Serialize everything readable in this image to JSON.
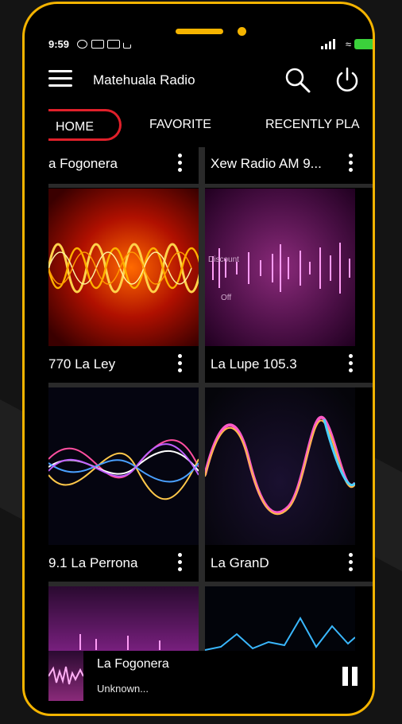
{
  "status_bar": {
    "time": "9:59"
  },
  "app_bar": {
    "title": "Matehuala Radio"
  },
  "tabs": [
    {
      "label": "HOME",
      "active": true
    },
    {
      "label": "FAVORITE",
      "active": false
    },
    {
      "label": "RECENTLY PLA",
      "active": false
    }
  ],
  "stations": [
    {
      "name": "a Fogonera"
    },
    {
      "name": "Xew Radio AM 9..."
    },
    {
      "name": "770 La Ley"
    },
    {
      "name": "La Lupe 105.3"
    },
    {
      "name": "9.1 La Perrona"
    },
    {
      "name": "La GranD"
    }
  ],
  "art_text": {
    "discount": "Discount",
    "off": "Off"
  },
  "player": {
    "title": "La Fogonera",
    "subtitle": "Unknown..."
  },
  "colors": {
    "frame": "#f5b400",
    "active_tab": "#e0202a",
    "battery": "#3bd13b"
  }
}
